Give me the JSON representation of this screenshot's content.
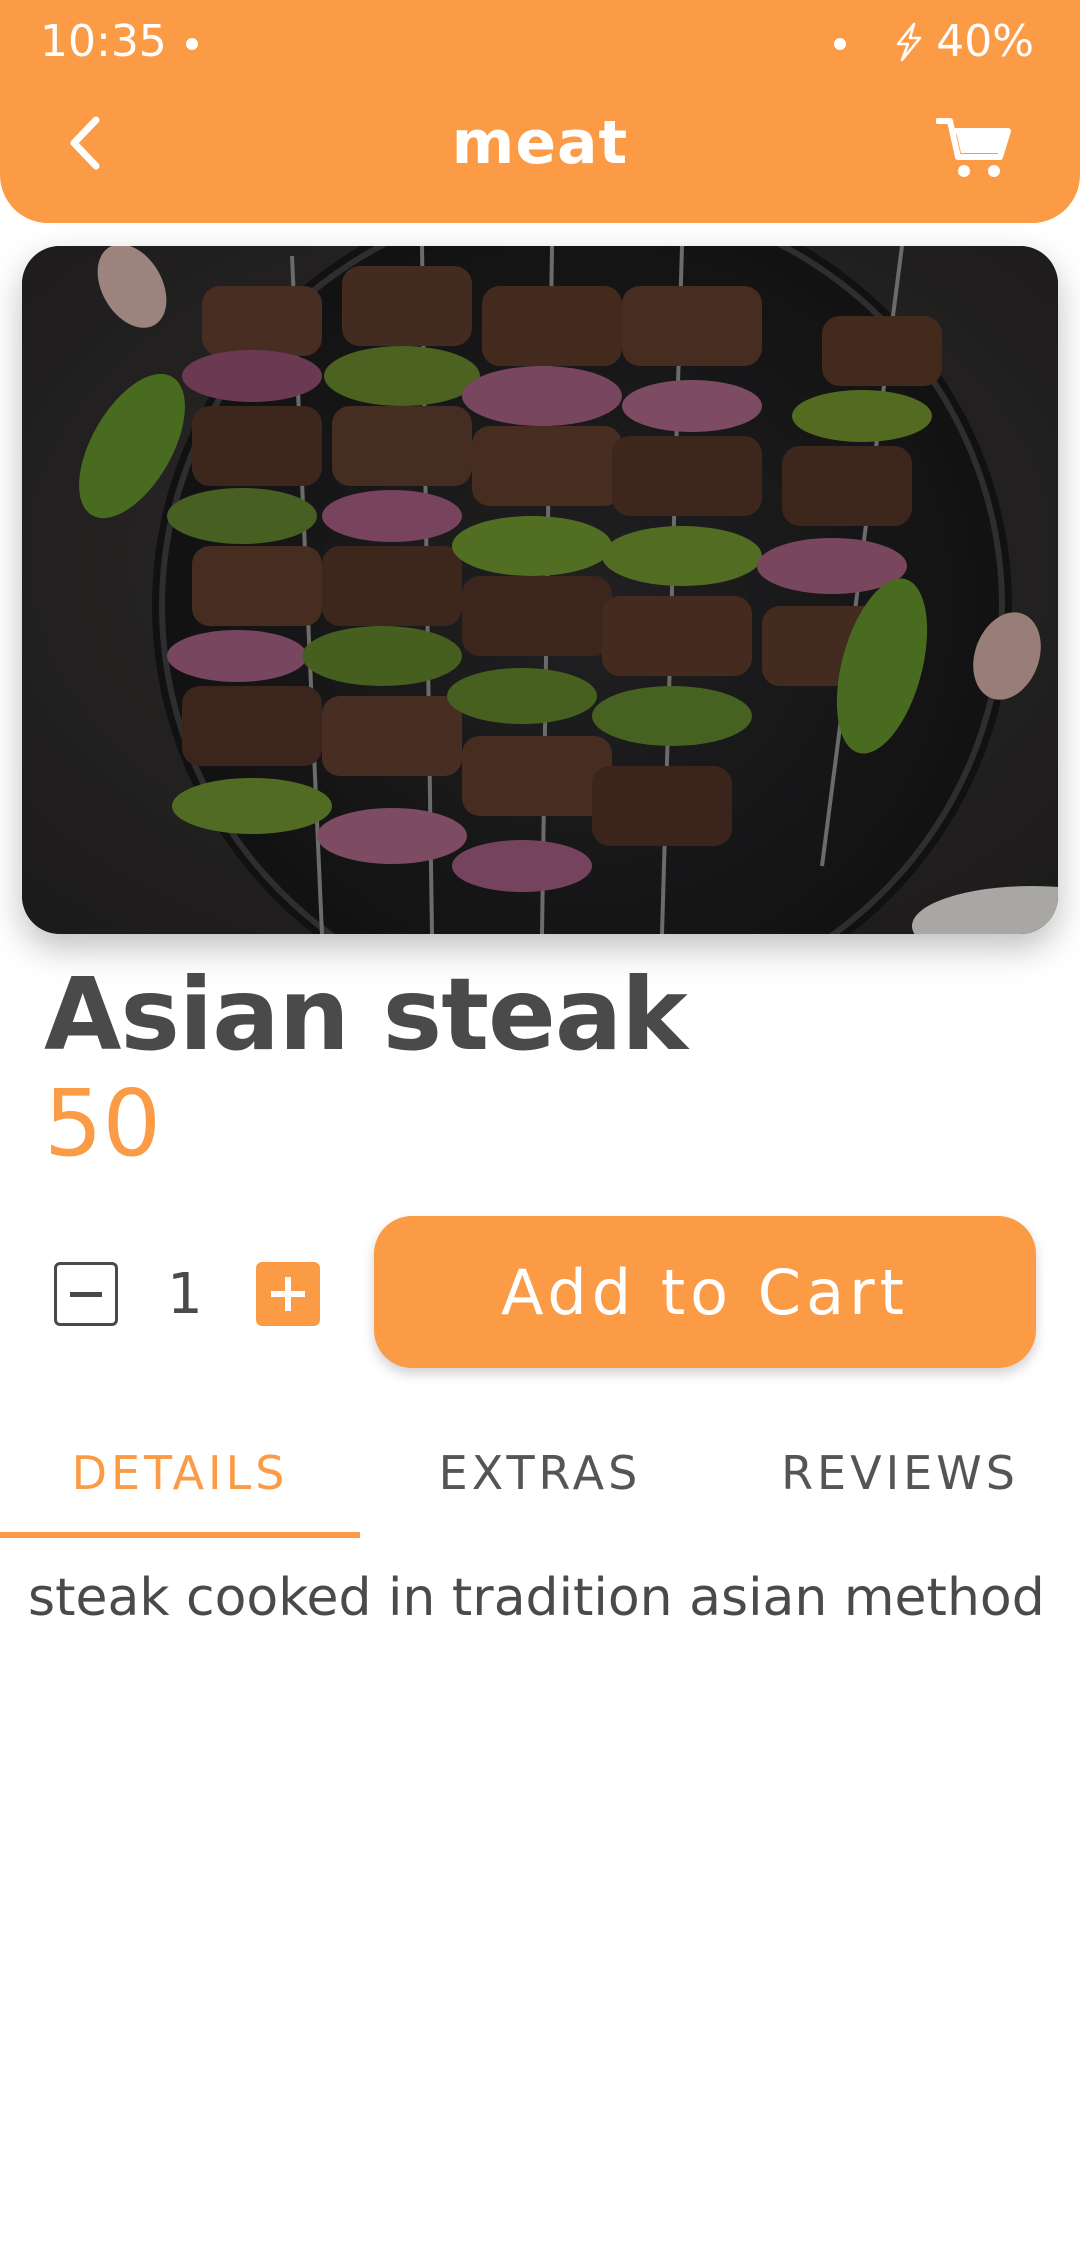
{
  "status_bar": {
    "time": "10:35",
    "battery": "40%"
  },
  "header": {
    "title": "meat",
    "back_icon": "chevron-left-icon",
    "cart_icon": "cart-icon"
  },
  "product": {
    "image_description": "grilled steak skewers with peppers and onions",
    "name": "Asian steak",
    "price": "50",
    "quantity": "1",
    "description": "steak cooked in tradition asian method"
  },
  "actions": {
    "add_to_cart": "Add to Cart"
  },
  "tabs": [
    {
      "label": "DETAILS",
      "active": true
    },
    {
      "label": "EXTRAS",
      "active": false
    },
    {
      "label": "REVIEWS",
      "active": false
    }
  ],
  "colors": {
    "accent": "#fb9b45",
    "text": "#4a4a4a",
    "background": "#ffffff"
  }
}
